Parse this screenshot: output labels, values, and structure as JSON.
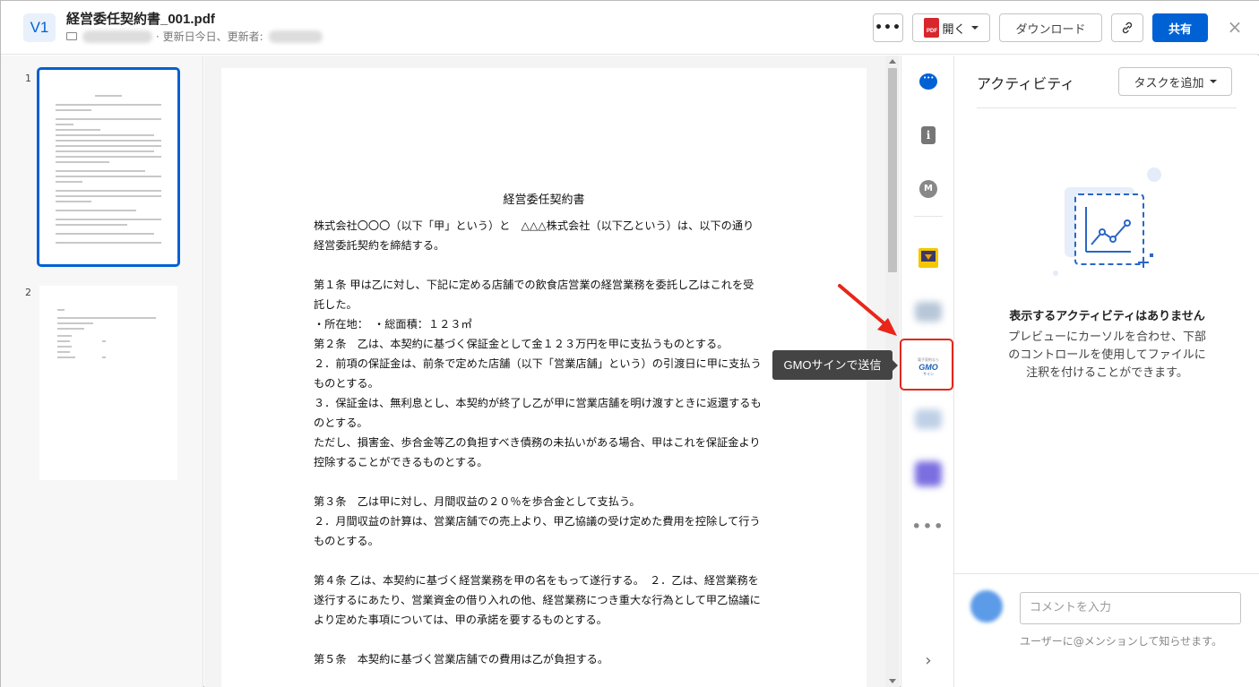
{
  "header": {
    "version_label": "V1",
    "file_name": "経営委任契約書_001.pdf",
    "meta_text": "· 更新日今日、更新者:",
    "more_label": "•••",
    "open_label": "開く",
    "pdf_badge": "PDF",
    "download_label": "ダウンロード",
    "share_label": "共有",
    "close_label": "×"
  },
  "thumbnails": {
    "pages": [
      {
        "number": "1"
      },
      {
        "number": "2"
      }
    ]
  },
  "document": {
    "title": "経営委任契約書",
    "lines": [
      "株式会社〇〇〇（以下「甲」という）と　△△△株式会社（以下乙という）は、以下の通り",
      "経営委託契約を締結する。",
      "",
      "第１条 甲は乙に対し、下記に定める店舗での飲食店営業の経営業務を委託し乙はこれを受",
      "託した。",
      "・所在地：　・総面積：１２３㎡",
      "第２条　乙は、本契約に基づく保証金として金１２３万円を甲に支払うものとする。",
      "２．前項の保証金は、前条で定めた店舗（以下「営業店舗」という）の引渡日に甲に支払う",
      "ものとする。",
      "３．保証金は、無利息とし、本契約が終了し乙が甲に営業店舗を明け渡すときに返還するも",
      "のとする。",
      "ただし、損害金、歩合金等乙の負担すべき債務の未払いがある場合、甲はこれを保証金より",
      "控除することができるものとする。",
      "",
      "第３条　乙は甲に対し、月間収益の２０％を歩合金として支払う。",
      "２．月間収益の計算は、営業店舗での売上より、甲乙協議の受け定めた費用を控除して行う",
      "ものとする。",
      "",
      "第４条 乙は、本契約に基づく経営業務を甲の名をもって遂行する。　２．乙は、経営業務を",
      "遂行するにあたり、営業資金の借り入れの他、経営業務につき重大な行為として甲乙協議に",
      "より定めた事項については、甲の承諾を要するものとする。",
      "",
      "第５条　本契約に基づく営業店舗での費用は乙が負担する。"
    ]
  },
  "rail": {
    "gmo_top": "電子契約なら",
    "gmo_main": "GMO",
    "gmo_sub": "サイン",
    "tooltip": "GMOサインで送信",
    "more_label": "•••",
    "collapse_label": "›"
  },
  "activity": {
    "title": "アクティビティ",
    "add_task_label": "タスクを追加",
    "empty_title": "表示するアクティビティはありません",
    "empty_desc": "プレビューにカーソルを合わせ、下部のコントロールを使用してファイルに注釈を付けることができます。",
    "comment_placeholder": "コメントを入力",
    "mention_hint": "ユーザーに@メンションして知らせます。"
  },
  "colors": {
    "accent": "#0061d5",
    "highlight": "#e2271b",
    "tooltip_bg": "#444444"
  }
}
